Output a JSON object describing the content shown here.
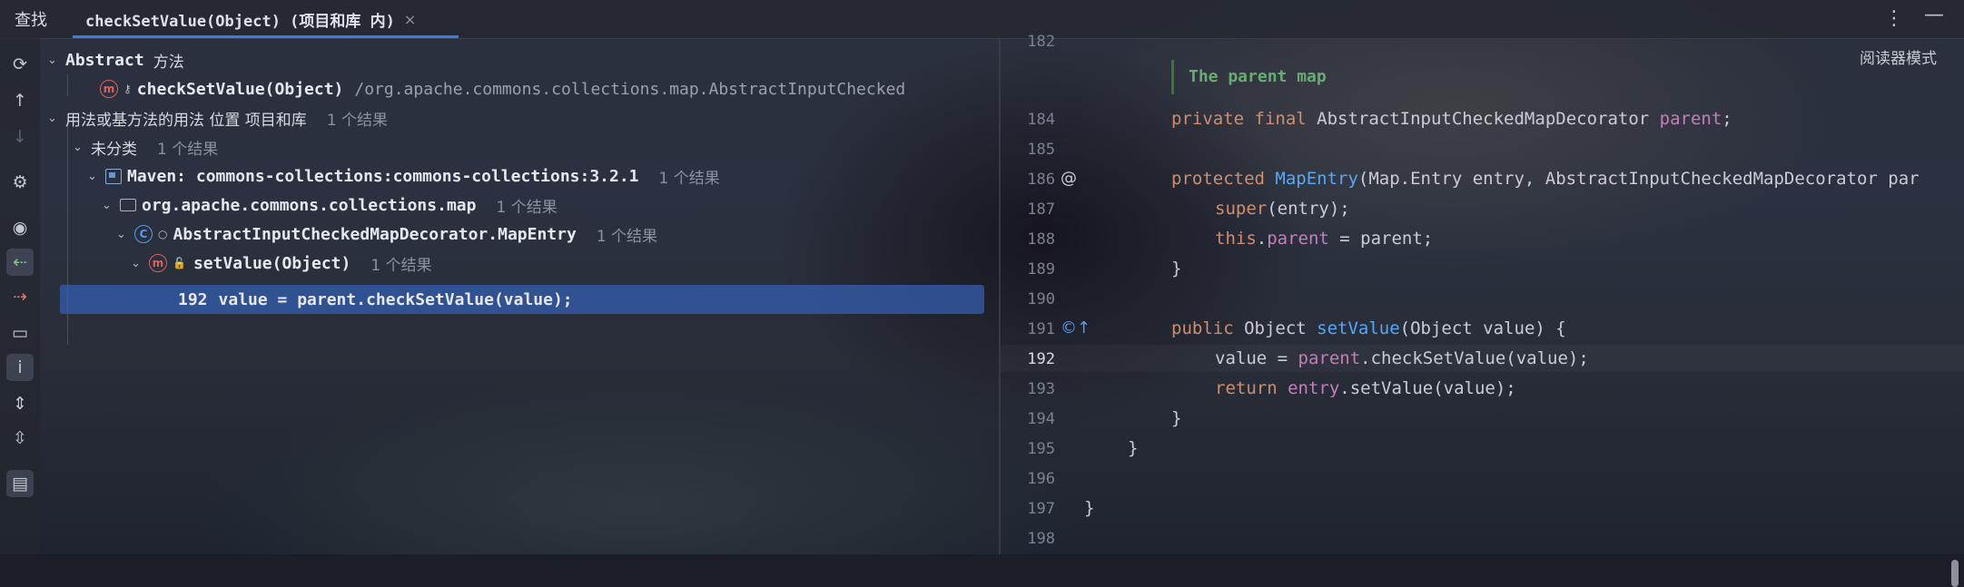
{
  "topbar": {
    "find_label": "查找",
    "tab_title": "checkSetValue(Object) (项目和库 内)",
    "tab_close": "×",
    "more": "⋮",
    "minimize": "—"
  },
  "toolbar": {
    "icons": [
      "refresh-icon",
      "arrow-up-icon",
      "arrow-down-icon",
      "settings-icon",
      "preview-eye-icon",
      "navigate-back-icon",
      "navigate-forward-icon",
      "folder-icon",
      "info-icon",
      "expand-all-icon",
      "collapse-all-icon",
      "layout-icon"
    ]
  },
  "tree": {
    "root_title": "Abstract",
    "root_suffix": "方法",
    "target_method": "checkSetValue(Object)",
    "target_path": "/org.apache.commons.collections.map.AbstractInputChecked",
    "usages_label": "用法或基方法的用法  位置  项目和库",
    "usages_count": "1 个结果",
    "uncategorized": "未分类",
    "uncategorized_count": "1 个结果",
    "maven": "Maven: commons-collections:commons-collections:3.2.1",
    "maven_count": "1 个结果",
    "package": "org.apache.commons.collections.map",
    "package_count": "1 个结果",
    "class": "AbstractInputCheckedMapDecorator.MapEntry",
    "class_count": "1 个结果",
    "method": "setValue(Object)",
    "method_count": "1 个结果",
    "usage_line_no": "192",
    "usage_line_code": "value = parent.checkSetValue(value);"
  },
  "editor": {
    "reader_mode": "阅读器模式",
    "doc_comment": "The parent map",
    "lines": {
      "l182": "182",
      "l184": "184",
      "l185": "185",
      "l186": "186",
      "l187": "187",
      "l188": "188",
      "l189": "189",
      "l190": "190",
      "l191": "191",
      "l192": "192",
      "l193": "193",
      "l194": "194",
      "l195": "195",
      "l196": "196",
      "l197": "197",
      "l198": "198"
    },
    "code": {
      "c184_kw": "private final ",
      "c184_type": "AbstractInputCheckedMapDecorator ",
      "c184_fld": "parent",
      "c184_end": ";",
      "c186_kw": "protected ",
      "c186_fn": "MapEntry",
      "c186_rest": "(Map.Entry entry, AbstractInputCheckedMapDecorator par",
      "c187_kw": "super",
      "c187_rest": "(entry);",
      "c188_kw": "this",
      "c188_dot": ".",
      "c188_fld": "parent",
      "c188_rest": " = parent;",
      "c189": "}",
      "c191_kw": "public ",
      "c191_type": "Object ",
      "c191_fn": "setValue",
      "c191_rest": "(Object value) {",
      "c192_a": "value = ",
      "c192_fld": "parent",
      "c192_b": ".checkSetValue(value);",
      "c193_kw": "return ",
      "c193_fld": "entry",
      "c193_rest": ".setValue(value);",
      "c194": "}",
      "c195": "}",
      "c197": "}"
    },
    "gutter_at": "@",
    "gutter_impl": "©↑"
  }
}
